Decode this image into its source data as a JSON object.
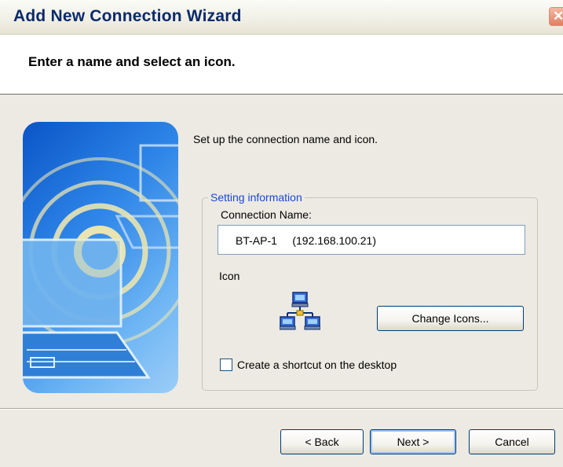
{
  "window": {
    "title": "Add New Connection Wizard"
  },
  "header": {
    "heading": "Enter a name and select an icon."
  },
  "main": {
    "instruction": "Set up the connection name and icon.",
    "group_label": "Setting information",
    "connection_name_label": "Connection Name:",
    "connection_name_value": "BT-AP-1     (192.168.100.21)",
    "icon_label": "Icon",
    "change_icons_label": "Change Icons...",
    "shortcut_label": "Create a shortcut on the desktop",
    "shortcut_checked": false
  },
  "footer": {
    "back_label": "< Back",
    "next_label": "Next >",
    "cancel_label": "Cancel"
  },
  "colors": {
    "title_text": "#0b2a6b",
    "group_legend": "#1a48d8",
    "panel_bg": "#eceae2"
  },
  "icons": [
    "close-icon",
    "network-icon",
    "wizard-illustration"
  ]
}
